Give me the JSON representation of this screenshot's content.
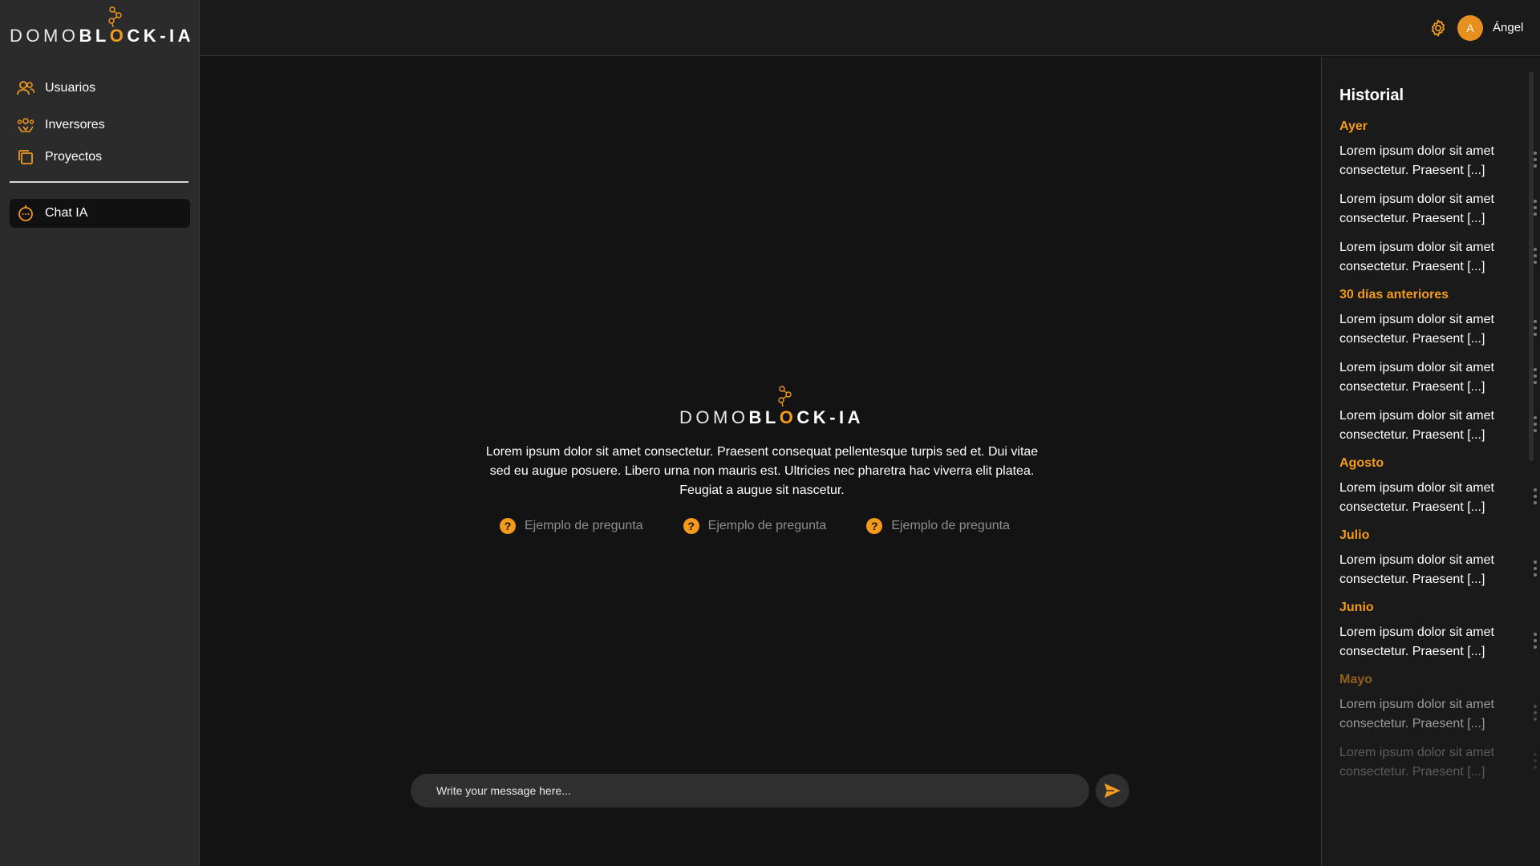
{
  "brand": {
    "part_light": "DOMO",
    "part_bold_1": "BL",
    "part_o": "O",
    "part_bold_2": "CK",
    "part_sep": "-",
    "part_ia": "IA"
  },
  "sidebar": {
    "items": [
      {
        "label": "Usuarios",
        "icon": "users-icon"
      },
      {
        "label": "Inversores",
        "icon": "investors-icon"
      },
      {
        "label": "Proyectos",
        "icon": "projects-icon"
      }
    ],
    "active_item": {
      "label": "Chat IA",
      "icon": "robot-icon"
    }
  },
  "topbar": {
    "avatar_initial": "A",
    "username": "Ángel",
    "settings_icon": "gear-icon"
  },
  "main": {
    "intro": "Lorem ipsum dolor sit amet consectetur. Praesent consequat pellentesque turpis sed et. Dui vitae sed eu augue posuere. Libero urna non mauris est. Ultricies nec pharetra hac viverra elit platea. Feugiat a augue sit nascetur.",
    "examples": [
      {
        "icon_glyph": "?",
        "label": "Ejemplo de pregunta"
      },
      {
        "icon_glyph": "?",
        "label": "Ejemplo de pregunta"
      },
      {
        "icon_glyph": "?",
        "label": "Ejemplo de pregunta"
      }
    ],
    "composer": {
      "placeholder": "Write your message here..."
    }
  },
  "history": {
    "title": "Historial",
    "groups": [
      {
        "label": "Ayer",
        "items": [
          {
            "line1": "Lorem ipsum dolor sit amet",
            "line2": "consectetur. Praesent [...]"
          },
          {
            "line1": "Lorem ipsum dolor sit amet",
            "line2": "consectetur. Praesent [...]"
          },
          {
            "line1": "Lorem ipsum dolor sit amet",
            "line2": "consectetur. Praesent [...]"
          }
        ]
      },
      {
        "label": "30 días anteriores",
        "items": [
          {
            "line1": "Lorem ipsum dolor sit amet",
            "line2": "consectetur. Praesent [...]"
          },
          {
            "line1": "Lorem ipsum dolor sit amet",
            "line2": "consectetur. Praesent [...]"
          },
          {
            "line1": "Lorem ipsum dolor sit amet",
            "line2": "consectetur. Praesent [...]"
          }
        ]
      },
      {
        "label": "Agosto",
        "items": [
          {
            "line1": "Lorem ipsum dolor sit amet",
            "line2": "consectetur. Praesent [...]"
          }
        ]
      },
      {
        "label": "Julio",
        "items": [
          {
            "line1": "Lorem ipsum dolor sit amet",
            "line2": "consectetur. Praesent [...]"
          }
        ]
      },
      {
        "label": "Junio",
        "items": [
          {
            "line1": "Lorem ipsum dolor sit amet",
            "line2": "consectetur. Praesent [...]"
          }
        ]
      },
      {
        "label": "Mayo",
        "items": [
          {
            "line1": "Lorem ipsum dolor sit amet",
            "line2": "consectetur. Praesent [...]"
          },
          {
            "line1": "Lorem ipsum dolor sit amet",
            "line2": "consectetur. Praesent [...]"
          }
        ]
      }
    ]
  },
  "colors": {
    "accent": "#f39a1c",
    "sidebar_bg": "#2b2b2b",
    "main_bg": "#131313",
    "panel_bg": "#1a1a1a"
  }
}
